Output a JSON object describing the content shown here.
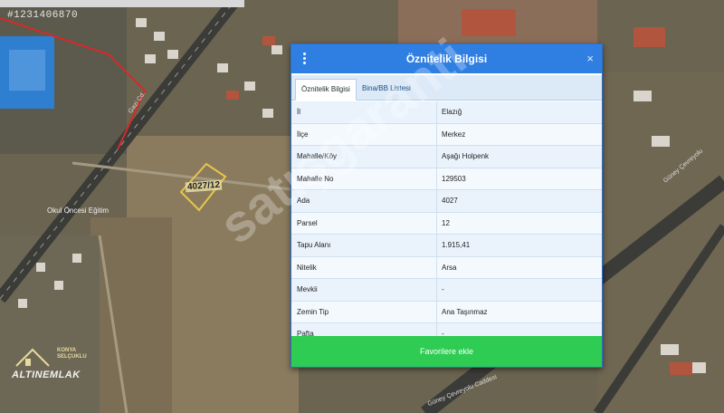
{
  "listing": {
    "number": "#1231406870"
  },
  "map": {
    "parcel_label": "4027/12",
    "place_label": "Okul Öncesi Eğitim",
    "road_label_top": "Gazi Cd.",
    "road_label_right": "Güney Çevreyolu",
    "road_label_bottom": "Güney Çevreyolu Caddesi"
  },
  "logo": {
    "top_line1": "KONYA",
    "top_line2": "SELÇUKLU",
    "main": "ALTINEMLAK"
  },
  "watermark": "satışgaranti",
  "dialog": {
    "title": "Öznitelik Bilgisi",
    "close_label": "×",
    "tabs": [
      "Öznitelik Bilgisi",
      "Bina/BB Listesi"
    ],
    "rows": [
      {
        "key": "İl",
        "value": "Elazığ"
      },
      {
        "key": "İlçe",
        "value": "Merkez"
      },
      {
        "key": "Mahalle/Köy",
        "value": "Aşağı Holpenk"
      },
      {
        "key": "Mahalle No",
        "value": "129503"
      },
      {
        "key": "Ada",
        "value": "4027"
      },
      {
        "key": "Parsel",
        "value": "12"
      },
      {
        "key": "Tapu Alanı",
        "value": "1.915,41"
      },
      {
        "key": "Nitelik",
        "value": "Arsa"
      },
      {
        "key": "Mevkii",
        "value": "-"
      },
      {
        "key": "Zemin Tip",
        "value": "Ana Taşınmaz"
      },
      {
        "key": "Pafta",
        "value": "-"
      }
    ],
    "favorite_button": "Favorilere ekle"
  },
  "colors": {
    "header": "#2f7fe2",
    "button": "#2ecc52",
    "parcel_outline": "#e8c64a",
    "boundary": "#d62a2a"
  }
}
